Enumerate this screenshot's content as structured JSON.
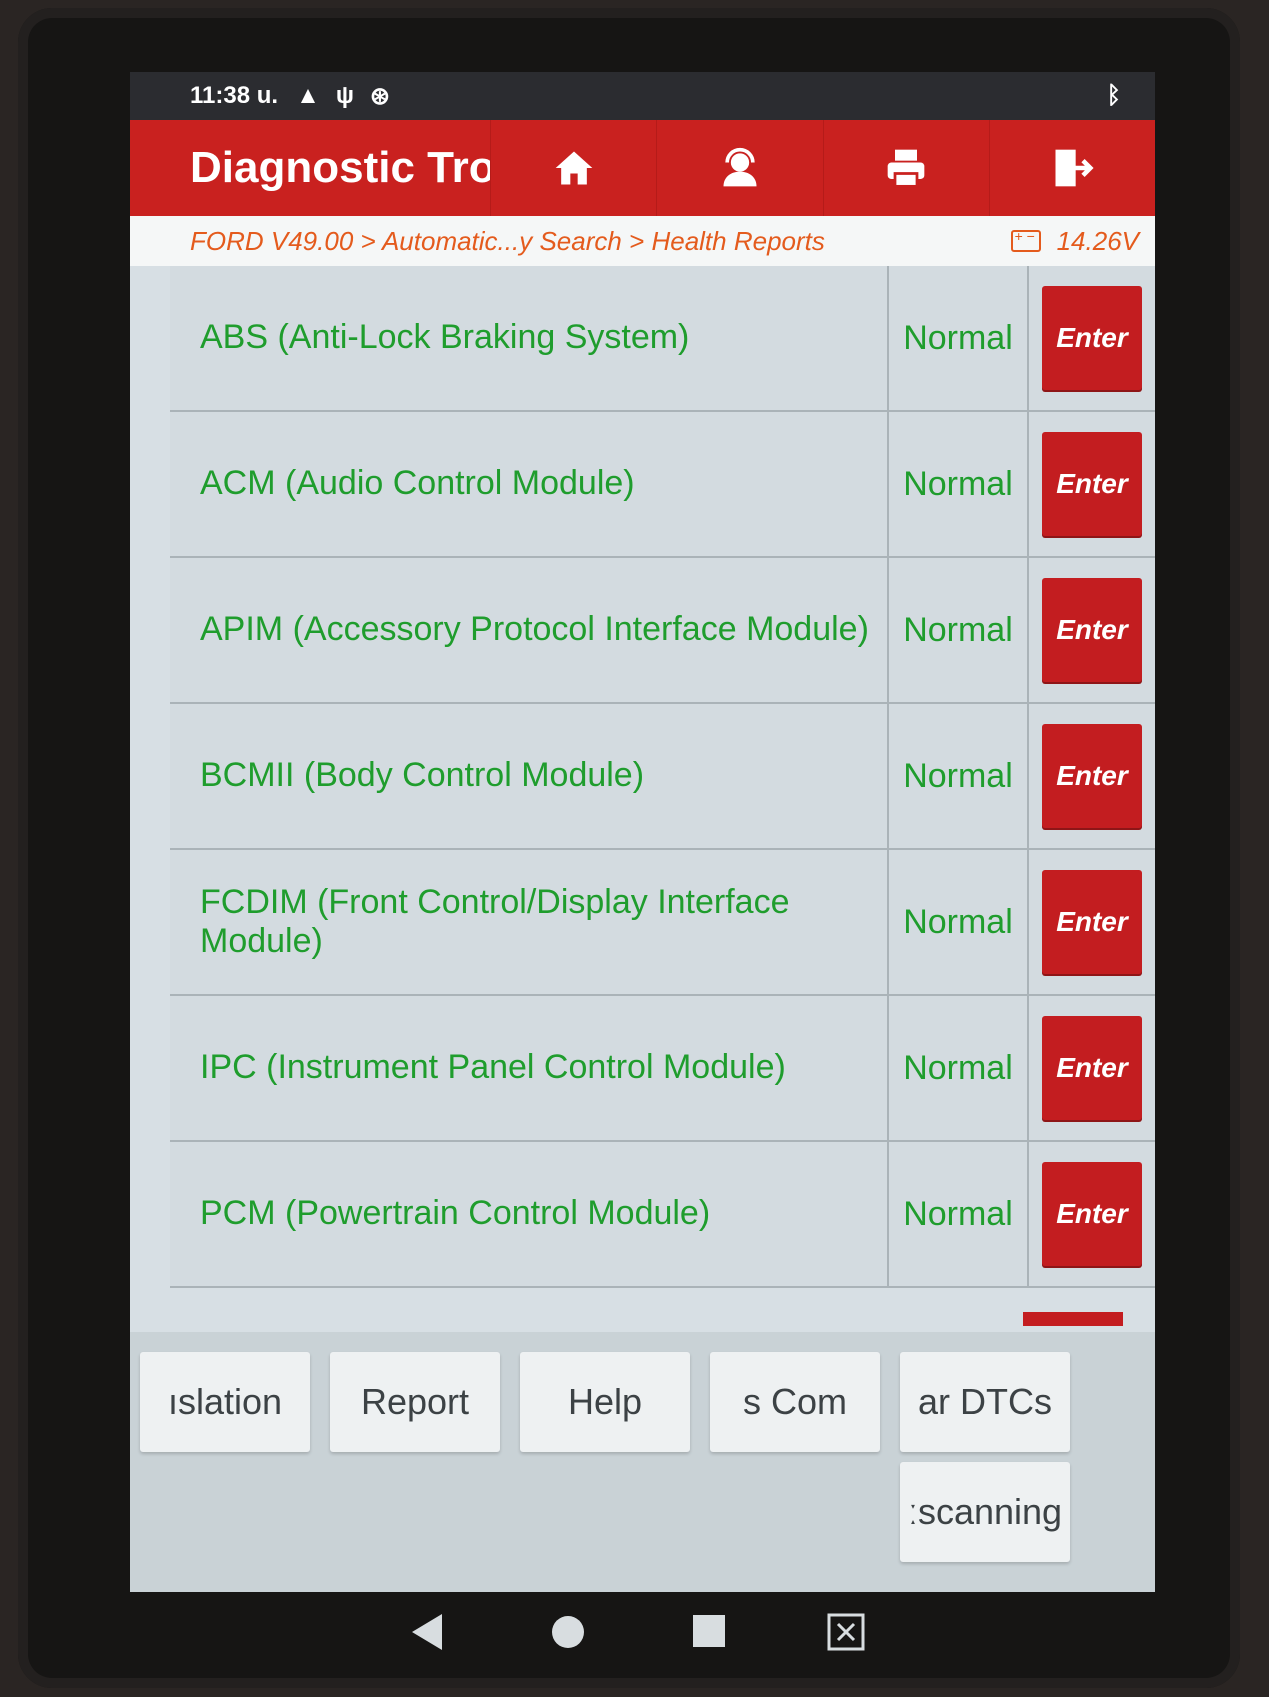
{
  "status_bar": {
    "time": "11:38 u.",
    "icons": [
      "warning-icon",
      "usb-debug-icon",
      "settings-icon",
      "bluetooth-icon"
    ]
  },
  "header": {
    "title": "Diagnostic Tro",
    "buttons": [
      "home-icon",
      "support-icon",
      "print-icon",
      "exit-icon"
    ]
  },
  "breadcrumb": {
    "path": "FORD V49.00 > Automatic...y Search > Health Reports",
    "voltage": "14.26V"
  },
  "modules": [
    {
      "name": "ABS (Anti-Lock Braking System)",
      "status": "Normal",
      "action": "Enter"
    },
    {
      "name": "ACM (Audio Control Module)",
      "status": "Normal",
      "action": "Enter"
    },
    {
      "name": "APIM (Accessory Protocol Interface Module)",
      "status": "Normal",
      "action": "Enter"
    },
    {
      "name": "BCMII (Body Control Module)",
      "status": "Normal",
      "action": "Enter"
    },
    {
      "name": "FCDIM (Front Control/Display Interface Module)",
      "status": "Normal",
      "action": "Enter"
    },
    {
      "name": "IPC (Instrument Panel Control Module)",
      "status": "Normal",
      "action": "Enter"
    },
    {
      "name": "PCM (Powertrain Control Module)",
      "status": "Normal",
      "action": "Enter"
    }
  ],
  "footer": {
    "translation": "ıslation",
    "report": "Report",
    "help": "Help",
    "components": "s     Com",
    "clear_dtcs": "ar DTCs",
    "rescanning": "ːscanning"
  },
  "colors": {
    "header_red": "#c9211f",
    "enter_red": "#c31d20",
    "status_green": "#1f9d2d",
    "breadcrumb_orange": "#e45b1d"
  }
}
